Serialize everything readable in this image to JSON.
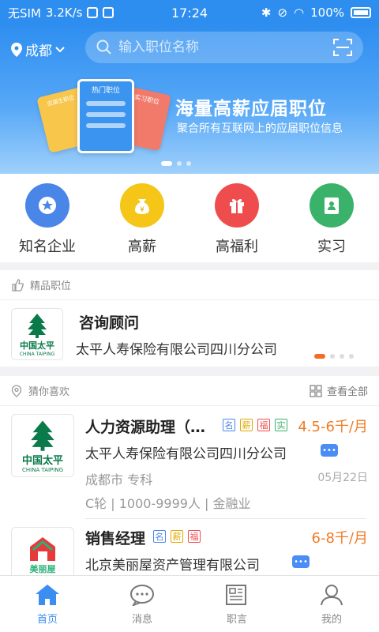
{
  "status_bar": {
    "carrier": "无SIM",
    "speed": "3.2K/s",
    "time": "17:24",
    "battery": "100%"
  },
  "header": {
    "location": "成都",
    "search_placeholder": "输入职位名称"
  },
  "banner": {
    "title": "海量高薪应届职位",
    "subtitle": "聚合所有互联网上的应届职位信息",
    "card_hot": "热门职位",
    "card_intern": "实习职位",
    "card_grad": "应届生职位"
  },
  "quick_nav": [
    {
      "label": "知名企业",
      "color": "#4a86e8",
      "icon": "star"
    },
    {
      "label": "高薪",
      "color": "#f5c518",
      "icon": "money-bag"
    },
    {
      "label": "高福利",
      "color": "#ef4d4d",
      "icon": "gift"
    },
    {
      "label": "实习",
      "color": "#3bb26a",
      "icon": "id-card"
    }
  ],
  "featured": {
    "section_title": "精品职位",
    "job_title": "咨询顾问",
    "company": "太平人寿保险有限公司四川分公司",
    "logo_cn": "中国太平",
    "logo_en": "CHINA TAIPING"
  },
  "recommend": {
    "section_title": "猜你喜欢",
    "view_all": "查看全部"
  },
  "jobs": [
    {
      "title": "人力资源助理（…",
      "tags": [
        "名",
        "薪",
        "福",
        "实"
      ],
      "salary": "4.5-6千/月",
      "company": "太平人寿保险有限公司四川分公司",
      "location": "成都市 专科",
      "date": "05月22日",
      "info": "C轮 | 1000-9999人 | 金融业",
      "logo_cn": "中国太平",
      "logo_en": "CHINA TAIPING"
    },
    {
      "title": "销售经理",
      "tags": [
        "名",
        "薪",
        "福"
      ],
      "salary": "6-8千/月",
      "company": "北京美丽屋资产管理有限公司",
      "logo_cn": "美丽屋"
    }
  ],
  "tab_bar": [
    {
      "label": "首页",
      "active": true
    },
    {
      "label": "消息",
      "active": false
    },
    {
      "label": "职言",
      "active": false
    },
    {
      "label": "我的",
      "active": false
    }
  ],
  "colors": {
    "brand_blue": "#2e8ef0",
    "salary_orange": "#f07c23",
    "tag_blue": "#4a86e8",
    "tag_yellow": "#e0a800",
    "tag_red": "#ef4d4d",
    "tag_green": "#3bb26a"
  }
}
